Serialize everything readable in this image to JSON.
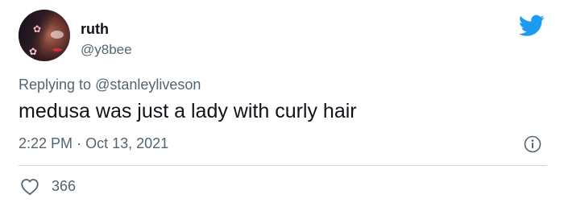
{
  "colors": {
    "brand_blue": "#1d9bf0",
    "text_primary": "#0f1419",
    "text_secondary": "#536471",
    "divider": "#cfd9de"
  },
  "author": {
    "display_name": "ruth",
    "handle": "@y8bee",
    "avatar_icon": "profile-photo"
  },
  "header": {
    "logo_icon": "twitter-bird-icon"
  },
  "reply": {
    "prefix": "Replying to",
    "mention": "@stanleyliveson"
  },
  "tweet": {
    "text": "medusa was just a lady with curly hair",
    "time": "2:22 PM",
    "separator": "·",
    "date": "Oct 13, 2021",
    "info_icon": "info-icon"
  },
  "engagement": {
    "like_icon": "heart-icon",
    "like_count": "366"
  }
}
